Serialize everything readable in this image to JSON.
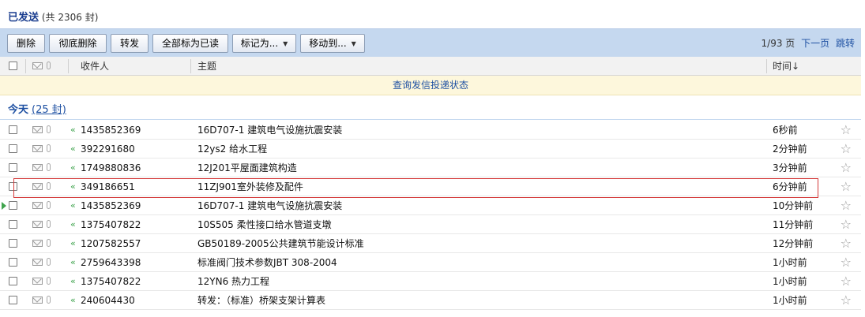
{
  "folder": {
    "title": "已发送",
    "count_text": "(共 2306 封)"
  },
  "toolbar": {
    "delete": "删除",
    "delete_forever": "彻底删除",
    "forward": "转发",
    "mark_all_read": "全部标为已读",
    "mark_as": "标记为...",
    "move_to": "移动到..."
  },
  "pager": {
    "page": "1/93 页",
    "next": "下一页",
    "jump": "跳转"
  },
  "columns": {
    "recipient": "收件人",
    "subject": "主题",
    "time": "时间↓"
  },
  "notice": "查询发信投递状态",
  "group": {
    "label": "今天",
    "count": "(25 封)"
  },
  "rows": [
    {
      "recipient": "1435852369",
      "subject": "16D707-1 建筑电气设施抗震安装",
      "time": "6秒前"
    },
    {
      "recipient": "392291680",
      "subject": "12ys2 给水工程",
      "time": "2分钟前"
    },
    {
      "recipient": "1749880836",
      "subject": "12J201平屋面建筑构造",
      "time": "3分钟前"
    },
    {
      "recipient": "349186651",
      "subject": "11ZJ901室外装修及配件",
      "time": "6分钟前"
    },
    {
      "recipient": "1435852369",
      "subject": "16D707-1 建筑电气设施抗震安装",
      "time": "10分钟前"
    },
    {
      "recipient": "1375407822",
      "subject": "10S505 柔性接口给水管道支墩",
      "time": "11分钟前"
    },
    {
      "recipient": "1207582557",
      "subject": "GB50189-2005公共建筑节能设计标准",
      "time": "12分钟前"
    },
    {
      "recipient": "2759643398",
      "subject": "标准阀门技术参数JBT 308-2004",
      "time": "1小时前"
    },
    {
      "recipient": "1375407822",
      "subject": "12YN6 热力工程",
      "time": "1小时前"
    },
    {
      "recipient": "240604430",
      "subject": "转发：（标准）桥架支架计算表",
      "time": "1小时前"
    }
  ],
  "icons": {
    "reply": "reply-arrow-icon",
    "star": "star-icon",
    "mail": "envelope-icon",
    "attachment": "paperclip-icon"
  }
}
